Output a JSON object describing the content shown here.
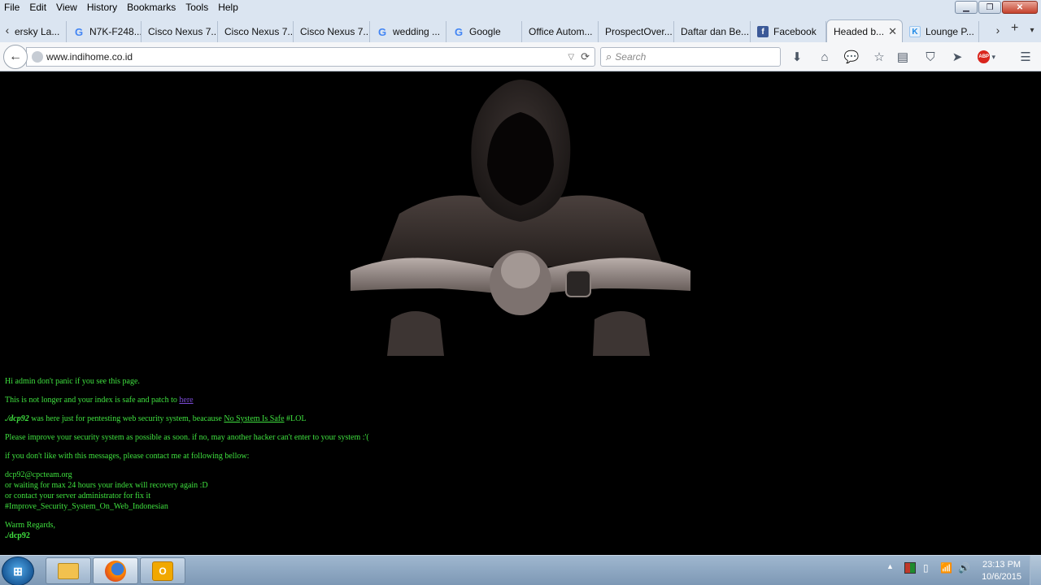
{
  "menu": [
    "File",
    "Edit",
    "View",
    "History",
    "Bookmarks",
    "Tools",
    "Help"
  ],
  "tabs": [
    {
      "label": "ersky La...",
      "icon": "none"
    },
    {
      "label": "N7K-F248...",
      "icon": "google"
    },
    {
      "label": "Cisco Nexus 7...",
      "icon": "none"
    },
    {
      "label": "Cisco Nexus 7...",
      "icon": "none"
    },
    {
      "label": "Cisco Nexus 7...",
      "icon": "none"
    },
    {
      "label": "wedding ...",
      "icon": "google"
    },
    {
      "label": "Google",
      "icon": "google"
    },
    {
      "label": "Office Autom...",
      "icon": "none"
    },
    {
      "label": "ProspectOver...",
      "icon": "none"
    },
    {
      "label": "Daftar dan Be...",
      "icon": "none"
    },
    {
      "label": "Facebook",
      "icon": "facebook"
    },
    {
      "label": "Headed b...",
      "icon": "none",
      "active": true
    },
    {
      "label": "Lounge P...",
      "icon": "k"
    }
  ],
  "nav": {
    "url": "www.indihome.co.id",
    "search_placeholder": "Search"
  },
  "page": {
    "line1": "Hi admin don't panic if you see this page.",
    "line2_text": "This is not longer and your index is safe and patch to ",
    "line2_link": "here",
    "line3_author": "./dcp92",
    "line3_mid": " was here just for pentesting web security system, beacause ",
    "line3_link": "No System Is Safe",
    "line3_end": " #LOL",
    "line4": "Please improve your security system as possible as soon. if no, may another hacker can't enter to your system :'(",
    "line5": "if you don't like with this messages, please contact me at following bellow:",
    "contact_email": "dcp92@cpcteam.org",
    "contact_2": "or waiting for max 24 hours your index will recovery again :D",
    "contact_3": "or contact your server administrator for fix it",
    "contact_4": "#Improve_Security_System_On_Web_Indonesian",
    "regards": "Warm Regards,",
    "signature": "./dcp92"
  },
  "taskbar": {
    "time": "23:13 PM",
    "date": "10/6/2015"
  },
  "colors": {
    "page_bg": "#000000",
    "message_text": "#3fe13f",
    "link": "#7b4bd6"
  }
}
